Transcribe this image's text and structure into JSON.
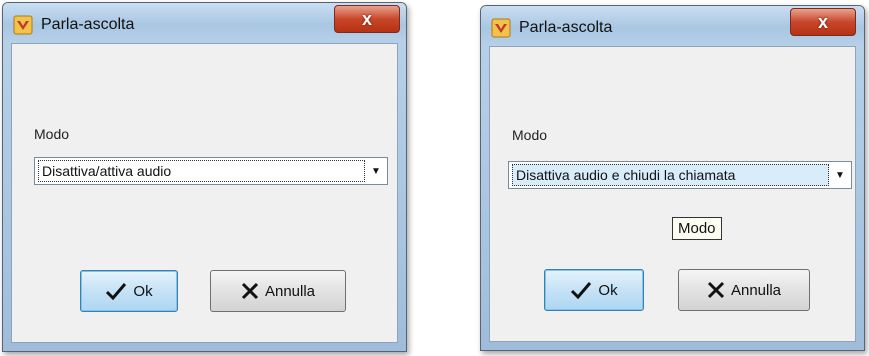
{
  "dialogs": [
    {
      "title": "Parla-ascolta",
      "close_symbol": "x",
      "field_label": "Modo",
      "combo_value": "Disattiva/attiva audio",
      "ok_label": "Ok",
      "cancel_label": "Annulla"
    },
    {
      "title": "Parla-ascolta",
      "close_symbol": "x",
      "field_label": "Modo",
      "combo_value": "Disattiva audio e chiudi la chiamata",
      "tooltip": "Modo",
      "ok_label": "Ok",
      "cancel_label": "Annulla"
    }
  ],
  "icons": {
    "app": "app-icon",
    "close": "close-icon",
    "dropdown": "chevron-down-icon",
    "ok": "checkmark-icon",
    "cancel": "x-icon"
  },
  "colors": {
    "titlebar": "#a9c6e2",
    "close_button": "#c8462b",
    "ok_button": "#c6e2f6",
    "selected_combo": "#d8ecfa"
  }
}
